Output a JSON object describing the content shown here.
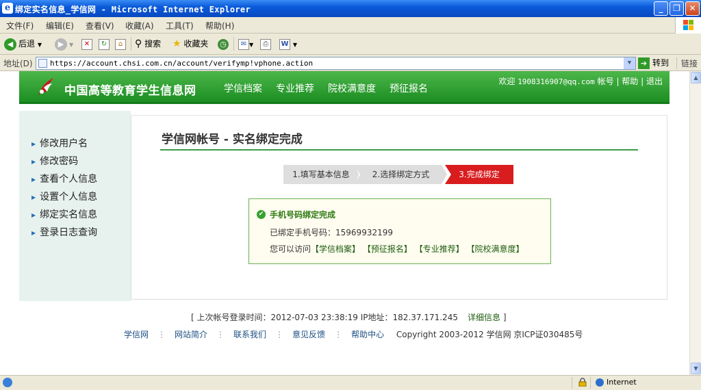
{
  "window": {
    "title": "绑定实名信息_学信网 - Microsoft Internet Explorer",
    "minimize": "_",
    "maximize": "❐",
    "close": "✕"
  },
  "menubar": {
    "items": [
      "文件(F)",
      "编辑(E)",
      "查看(V)",
      "收藏(A)",
      "工具(T)",
      "帮助(H)"
    ]
  },
  "toolbar": {
    "back": "后退",
    "search": "搜索",
    "favorites": "收藏夹"
  },
  "address": {
    "label": "地址(D)",
    "url": "https://account.chsi.com.cn/account/verifymp!vphone.action",
    "go": "转到",
    "links": "链接"
  },
  "site": {
    "name": "中国高等教育学生信息网",
    "nav": [
      "学信档案",
      "专业推荐",
      "院校满意度",
      "预征报名"
    ],
    "welcome_prefix": "欢迎",
    "user_email": "1908316907@qq.com",
    "account": "帐号",
    "help": "帮助",
    "logout": "退出"
  },
  "sidebar": {
    "items": [
      "修改用户名",
      "修改密码",
      "查看个人信息",
      "设置个人信息",
      "绑定实名信息",
      "登录日志查询"
    ]
  },
  "panel": {
    "title": "学信网帐号 - 实名绑定完成",
    "steps": [
      "1.填写基本信息",
      "2.选择绑定方式",
      "3.完成绑定"
    ],
    "success_title": "手机号码绑定完成",
    "bound_label": "已绑定手机号码：",
    "bound_phone": "15969932199",
    "visit_prefix": "您可以访问",
    "visit_links": [
      "【学信档案】",
      "【预征报名】",
      "【专业推荐】",
      "【院校满意度】"
    ]
  },
  "lastlogin": {
    "text": "[ 上次帐号登录时间：2012-07-03 23:38:19 IP地址：182.37.171.245",
    "detail": "详细信息",
    "close": "]"
  },
  "footer": {
    "links": [
      "学信网",
      "网站简介",
      "联系我们",
      "意见反馈",
      "帮助中心"
    ],
    "copyright": "Copyright 2003-2012 学信网 京ICP证030485号"
  },
  "status": {
    "zone": "Internet"
  },
  "colors": {
    "brand_green": "#2a9a2f",
    "active_step": "#d91c1e",
    "titlebar": "#0a5bd9"
  }
}
